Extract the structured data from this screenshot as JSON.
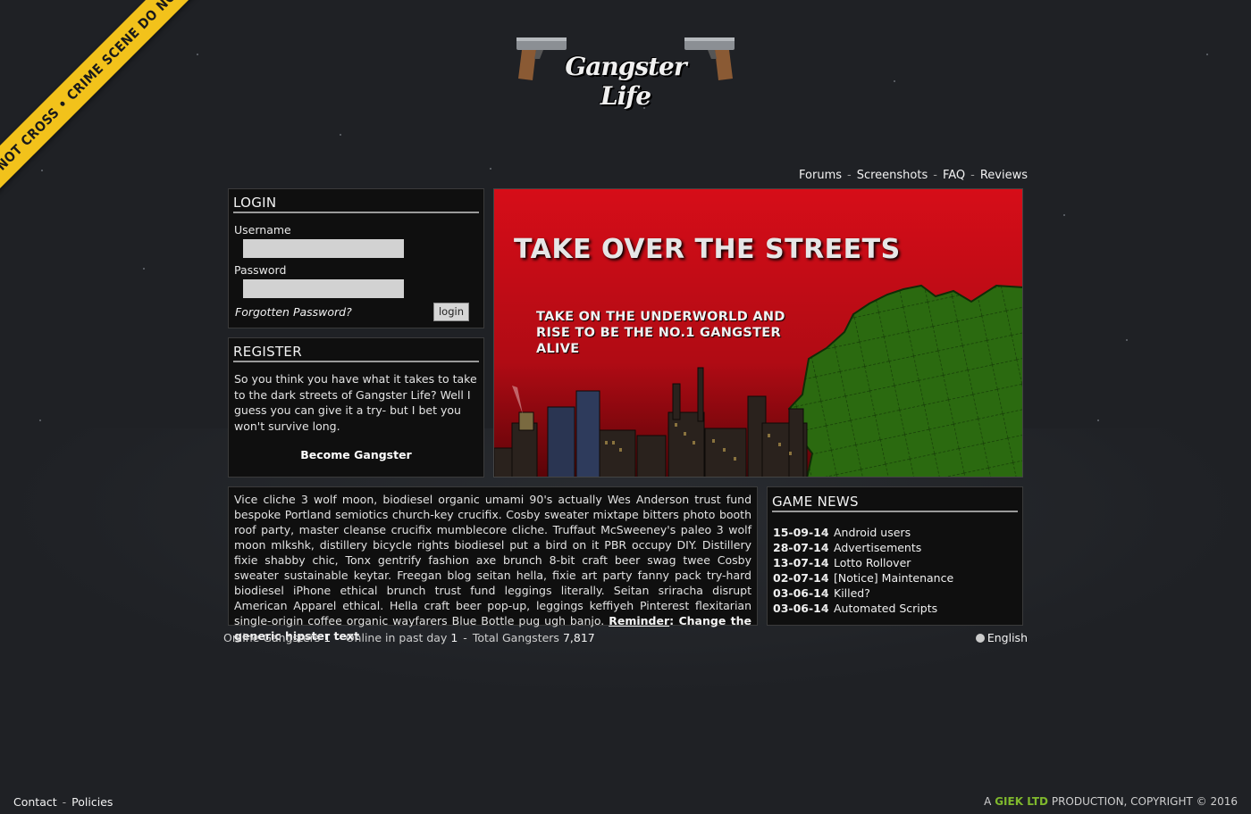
{
  "tape": {
    "text": "NOT CROSS • CRIME SCENE DO NOT"
  },
  "logo": {
    "text": "Gangster Life"
  },
  "topnav": {
    "items": [
      "Forums",
      "Screenshots",
      "FAQ",
      "Reviews"
    ],
    "separator": "-"
  },
  "login": {
    "title": "LOGIN",
    "username_label": "Username",
    "username_value": "",
    "password_label": "Password",
    "password_value": "",
    "forgot_label": "Forgotten Password?",
    "submit_label": "login"
  },
  "register": {
    "title": "REGISTER",
    "text": "So you think you have what it takes to take to the dark streets of Gangster Life? Well I guess you can give it a try- but I bet you won't survive long.",
    "cta": "Become Gangster"
  },
  "banner": {
    "title": "TAKE OVER THE STREETS",
    "subtitle": "TAKE ON THE UNDERWORLD AND RISE TO BE THE NO.1 GANGSTER ALIVE"
  },
  "intro": {
    "text": "Vice cliche 3 wolf moon, biodiesel organic umami 90's actually Wes Anderson trust fund bespoke Portland semiotics church-key crucifix. Cosby sweater mixtape bitters photo booth roof party, master cleanse crucifix mumblecore cliche. Truffaut McSweeney's paleo 3 wolf moon mlkshk, distillery bicycle rights biodiesel put a bird on it PBR occupy DIY. Distillery fixie shabby chic, Tonx gentrify fashion axe brunch 8-bit craft beer swag twee Cosby sweater sustainable keytar. Freegan blog seitan hella, fixie art party fanny pack try-hard biodiesel iPhone ethical brunch trust fund leggings literally. Seitan sriracha disrupt American Apparel ethical. Hella craft beer pop-up, leggings keffiyeh Pinterest flexitarian single-origin coffee organic wayfarers Blue Bottle pug ugh banjo.",
    "reminder_label": "Reminder",
    "reminder_text": ": Change the generic hipster text"
  },
  "news": {
    "title": "GAME NEWS",
    "items": [
      {
        "date": "15-09-14",
        "title": "Android users"
      },
      {
        "date": "28-07-14",
        "title": "Advertisements"
      },
      {
        "date": "13-07-14",
        "title": "Lotto Rollover"
      },
      {
        "date": "02-07-14",
        "title": "[Notice] Maintenance"
      },
      {
        "date": "03-06-14",
        "title": "Killed?"
      },
      {
        "date": "03-06-14",
        "title": "Automated Scripts"
      }
    ]
  },
  "stats": {
    "online_label": "Online Gangsters",
    "online_value": "1",
    "day_label": "Online in past day",
    "day_value": "1",
    "total_label": "Total Gangsters",
    "total_value": "7,817"
  },
  "language": "English",
  "footer": {
    "contact": "Contact",
    "policies": "Policies",
    "copy_prefix": "A",
    "brand": "GIEK LTD",
    "copy_suffix": "PRODUCTION, COPYRIGHT © 2016"
  },
  "colors": {
    "background": "#1f2125",
    "banner_red": "#c8101a",
    "brand_green": "#7fb82d",
    "tape_yellow": "#f2c21b"
  }
}
